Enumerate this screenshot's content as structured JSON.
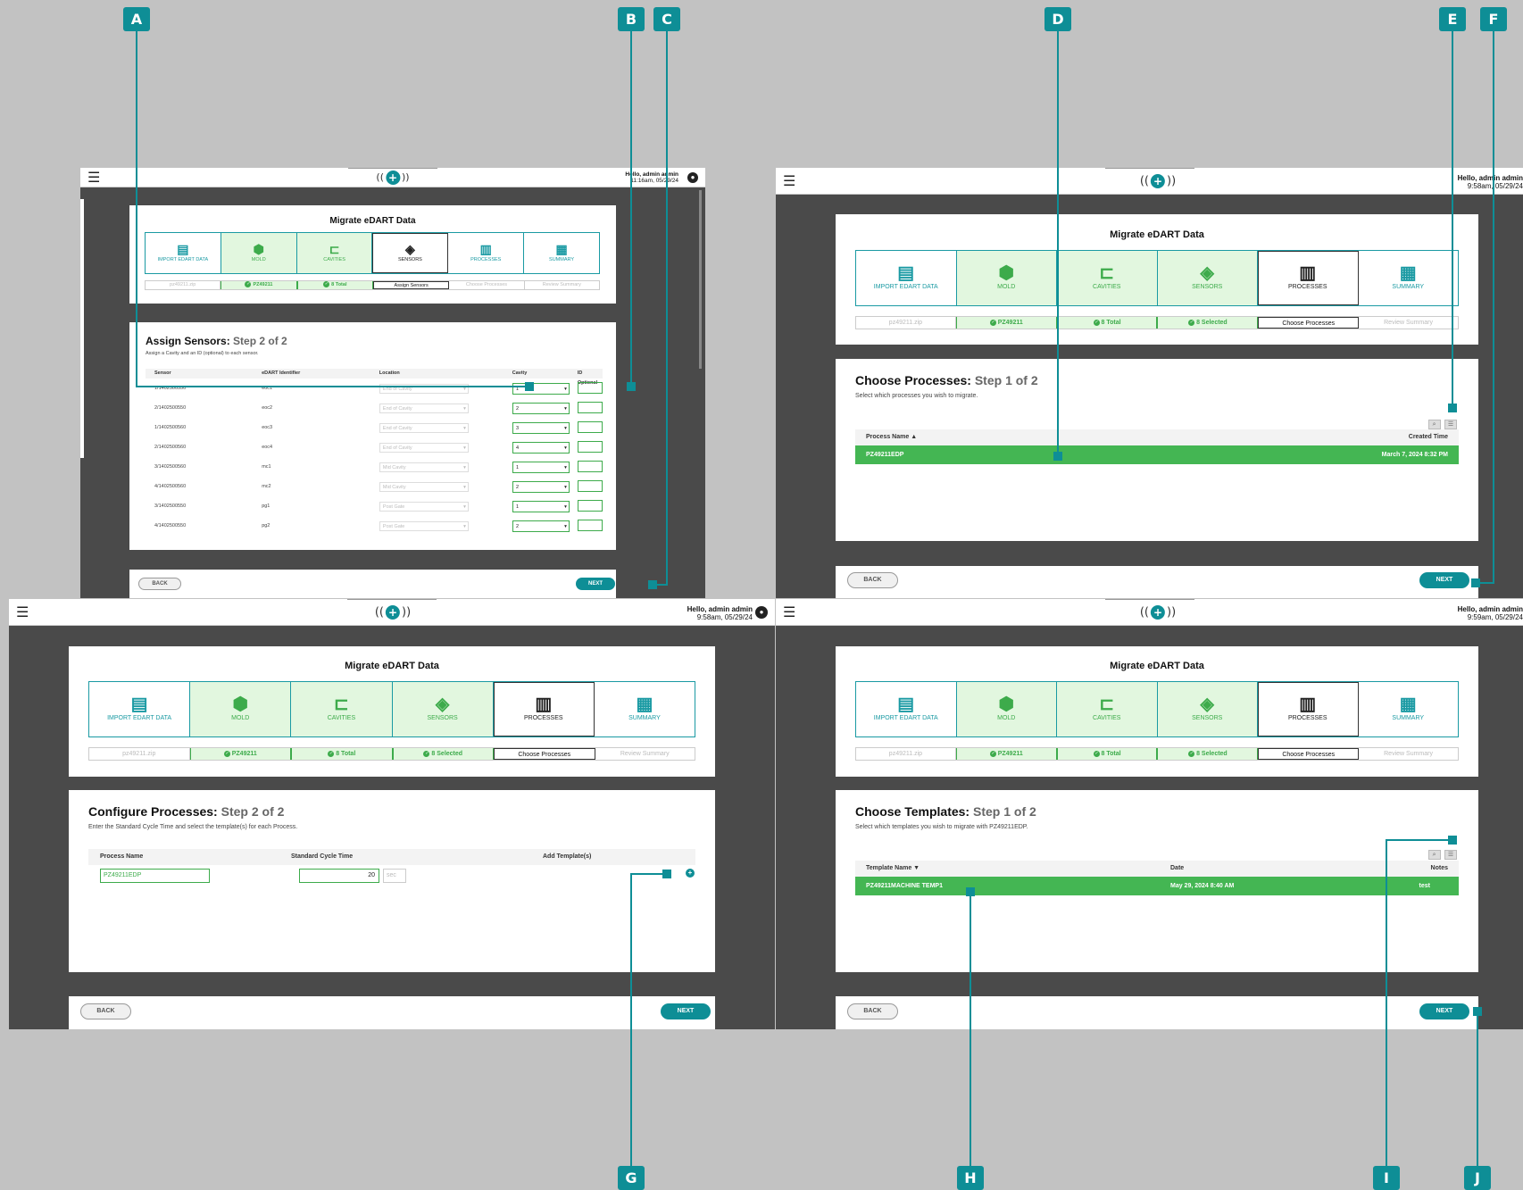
{
  "header": {
    "greeting": "Hello, admin admin",
    "time1": "11:16am, 05/29/24",
    "time2": "9:58am, 05/29/24",
    "time3": "9:59am, 05/29/24",
    "logo_plus": "+",
    "logo_left": "((",
    "logo_right": "))"
  },
  "migrate_title": "Migrate eDART Data",
  "steps": [
    "IMPORT EDART DATA",
    "MOLD",
    "CAVITIES",
    "SENSORS",
    "PROCESSES",
    "SUMMARY"
  ],
  "step_icons": [
    "document-icon",
    "cube-icon",
    "bracket-icon",
    "sensor-target-icon",
    "process-icon",
    "summary-list-icon"
  ],
  "chips_sensors": {
    "file": "pz49211.zip",
    "mold": "PZ49211",
    "cav": "8 Total",
    "cur": "Assign Sensors",
    "proc": "Choose Processes",
    "sum": "Review Summary"
  },
  "chips_process": {
    "file": "pz49211.zip",
    "mold": "PZ49211",
    "cav": "8 Total",
    "sens": "8 Selected",
    "cur": "Choose Processes",
    "sum": "Review Summary"
  },
  "assign": {
    "title": "Assign Sensors:",
    "step": "Step 2 of 2",
    "sub": "Assign a Cavity and an ID (optional) to each sensor.",
    "cols": [
      "Sensor",
      "eDART Identifier",
      "Location",
      "Cavity",
      "ID Optional"
    ],
    "rows": [
      {
        "sensor": "1/1402500550",
        "id": "eoc1",
        "loc": "End of Cavity",
        "cav": "1"
      },
      {
        "sensor": "2/1402500550",
        "id": "eoc2",
        "loc": "End of Cavity",
        "cav": "2"
      },
      {
        "sensor": "1/1402500560",
        "id": "eoc3",
        "loc": "End of Cavity",
        "cav": "3"
      },
      {
        "sensor": "2/1402500560",
        "id": "eoc4",
        "loc": "End of Cavity",
        "cav": "4"
      },
      {
        "sensor": "3/1402500560",
        "id": "mc1",
        "loc": "Mid Cavity",
        "cav": "1"
      },
      {
        "sensor": "4/1402500560",
        "id": "mc2",
        "loc": "Mid Cavity",
        "cav": "2"
      },
      {
        "sensor": "3/1402500550",
        "id": "pg1",
        "loc": "Post Gate",
        "cav": "1"
      },
      {
        "sensor": "4/1402500550",
        "id": "pg2",
        "loc": "Post Gate",
        "cav": "2"
      }
    ]
  },
  "choose_proc": {
    "title": "Choose Processes:",
    "step": "Step 1 of 2",
    "sub": "Select which processes you wish to migrate.",
    "cols": [
      "Process Name ▲",
      "Created Time"
    ],
    "row": {
      "name": "PZ49211EDP",
      "time": "March 7, 2024 8:32 PM"
    }
  },
  "config_proc": {
    "title": "Configure Processes:",
    "step": "Step 2 of 2",
    "sub": "Enter the Standard Cycle Time and select the template(s) for each Process.",
    "cols": [
      "Process Name",
      "Standard Cycle Time",
      "Add Template(s)"
    ],
    "name": "PZ49211EDP",
    "cycle": "20",
    "unit": "sec",
    "add": "+"
  },
  "choose_tmpl": {
    "title": "Choose Templates:",
    "step": "Step 1 of 2",
    "sub": "Select which templates you wish to migrate with PZ49211EDP.",
    "cols": [
      "Template Name ▼",
      "Date",
      "Notes"
    ],
    "row": {
      "name": "PZ49211MACHINE TEMP1",
      "date": "May 29, 2024 8:40 AM",
      "notes": "test"
    }
  },
  "buttons": {
    "back": "BACK",
    "next": "NEXT",
    "search": "⌕",
    "filter": "☰"
  },
  "callouts": [
    "A",
    "B",
    "C",
    "D",
    "E",
    "F",
    "G",
    "H",
    "I",
    "J"
  ],
  "colors": {
    "teal": "#0e8e96",
    "green": "#44b653",
    "light_green": "#e2f7df"
  }
}
